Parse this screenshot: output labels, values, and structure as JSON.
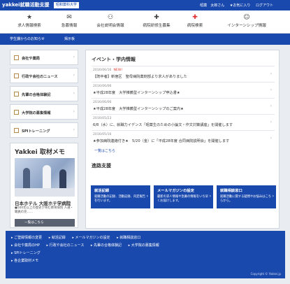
{
  "header": {
    "logo": "yakkei就職活動支援",
    "school": "昭和薬科大学",
    "links": [
      "昭薬　太郎さん",
      "★お気に入り",
      "ログアウト"
    ]
  },
  "nav": {
    "items": [
      {
        "icon": "★",
        "label": "求人情報検索",
        "icon_name": "star-icon"
      },
      {
        "icon": "✉",
        "label": "急募情報",
        "icon_name": "mail-icon"
      },
      {
        "icon": "⚇",
        "label": "会社説明会情報",
        "icon_name": "people-icon"
      },
      {
        "icon": "✚",
        "label": "病院研修生募集",
        "icon_name": "medical-cross-icon"
      },
      {
        "icon": "✚",
        "label": "病院検索",
        "icon_name": "hospital-icon"
      },
      {
        "icon": "☺",
        "label": "インターンシップ情報",
        "icon_name": "person-icon"
      }
    ]
  },
  "subbar": {
    "links": [
      "学生課からのお知らせ",
      "掲示板"
    ]
  },
  "sidebar": {
    "items": [
      "会社や薬局",
      "行政や会社のニュース",
      "先輩の合格体験記",
      "大学院の募集情報",
      "SPIトレーニング"
    ]
  },
  "yakkei": {
    "title": "Yakkei 取材メモ",
    "caption": "日本ホテル 大阪ホテ学病院",
    "text": "●500年以上の歴史が育む教育病院 人選・職員の充……",
    "more": "一覧はこちら"
  },
  "events": {
    "title": "イベント・学内情報",
    "new_label": "NEW!",
    "items": [
      {
        "date": "2016/06/16",
        "new": true,
        "title": "【既卒者】新宿区　聖母病院薬剤部より求人がありました"
      },
      {
        "date": "2016/06/06",
        "new": false,
        "title": "★平成28年度　大学推薦型インターンシップ申込書★"
      },
      {
        "date": "2016/06/06",
        "new": false,
        "title": "★平成28年度　大学推薦型インターンシップのご案内★"
      },
      {
        "date": "2016/05/23",
        "new": false,
        "title": "6/8（水）に、就職力イデンス「昭薬生のための小論文・作文対策講座」を開催します"
      },
      {
        "date": "2016/05/16",
        "new": false,
        "title": "★参加病院連絡付き★　5/20（金）に「平成28年度 合同病院説明会」を開催します"
      }
    ],
    "more": "一覧はこちら"
  },
  "careers": {
    "title": "進路支援",
    "cards": [
      {
        "title": "就活記録",
        "desc": "就職活動の記録、活動記録、内定報告を行います。"
      },
      {
        "title": "メールマガジンの設定",
        "desc": "最新の求人情報や急募の情報をいち早くお届けします。"
      },
      {
        "title": "就職相談窓口",
        "desc": "就職活動に関する疑問やお悩みはこちらから。"
      }
    ]
  },
  "footer": {
    "rows": [
      [
        "▸ ご登録情報の変更",
        "▸ 就活記録",
        "▸ メールマガジンの設定",
        "▸ 就職相談窓口"
      ],
      [
        "▸ 会社や薬局のHP",
        "▸ 行政や会社のニュース",
        "▸ 先輩の合格体験記",
        "▸ 大学院の募集情報"
      ],
      [
        "▸ SPIトレーニング"
      ],
      [
        "▸ 各企業取材メモ"
      ]
    ],
    "copyright": "Copyright © Yakkei.jp"
  }
}
